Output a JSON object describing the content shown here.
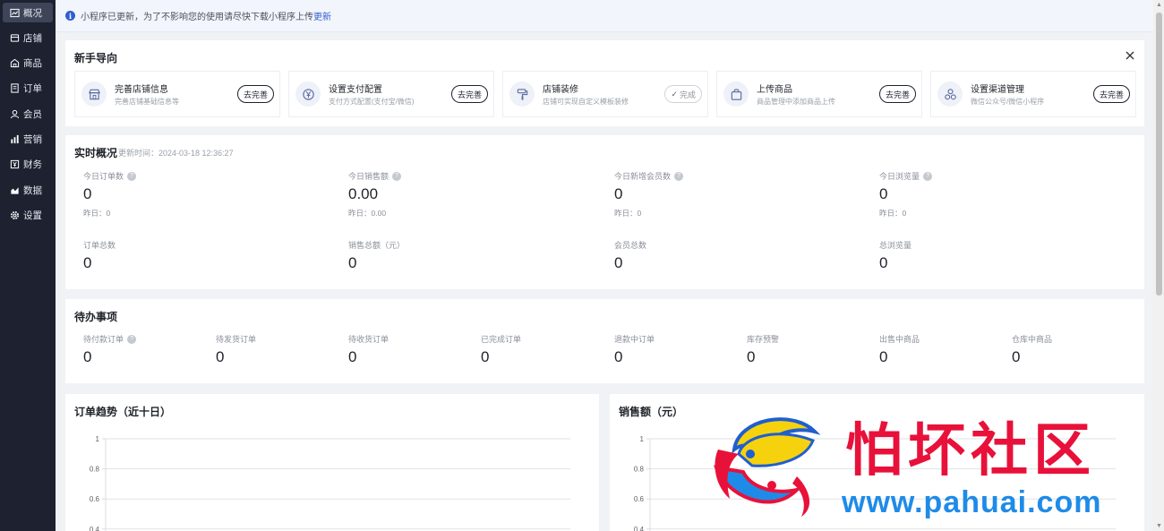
{
  "sidebar": {
    "items": [
      {
        "label": "概况",
        "icon": "chart-icon"
      },
      {
        "label": "店铺",
        "icon": "store-icon"
      },
      {
        "label": "商品",
        "icon": "goods-icon"
      },
      {
        "label": "订单",
        "icon": "order-icon"
      },
      {
        "label": "会员",
        "icon": "member-icon"
      },
      {
        "label": "营销",
        "icon": "marketing-icon"
      },
      {
        "label": "财务",
        "icon": "finance-icon"
      },
      {
        "label": "数据",
        "icon": "data-icon"
      },
      {
        "label": "设置",
        "icon": "settings-icon"
      }
    ]
  },
  "notice": {
    "text": "小程序已更新，为了不影响您的使用请尽快下载小程序上传",
    "link": "更新"
  },
  "guide": {
    "title": "新手导向",
    "items": [
      {
        "name": "完善店铺信息",
        "desc": "完善店铺基础信息等",
        "button": "去完善",
        "done": false
      },
      {
        "name": "设置支付配置",
        "desc": "支付方式配置(支付宝/微信)",
        "button": "去完善",
        "done": false
      },
      {
        "name": "店铺装修",
        "desc": "店铺可实现自定义模板装修",
        "button": "完成",
        "done": true
      },
      {
        "name": "上传商品",
        "desc": "商品管理中添加商品上传",
        "button": "去完善",
        "done": false
      },
      {
        "name": "设置渠道管理",
        "desc": "微信公众号/微信小程序",
        "button": "去完善",
        "done": false
      }
    ]
  },
  "realtime": {
    "title": "实时概况",
    "update_time": "更新时间：2024-03-18 12:36:27",
    "stats": [
      {
        "label": "今日订单数",
        "value": "0",
        "sub": "昨日：0",
        "help": true
      },
      {
        "label": "今日销售额",
        "value": "0.00",
        "sub": "昨日：0.00",
        "help": true
      },
      {
        "label": "今日新增会员数",
        "value": "0",
        "sub": "昨日：0",
        "help": true
      },
      {
        "label": "今日浏览量",
        "value": "0",
        "sub": "昨日：0",
        "help": true
      },
      {
        "label": "订单总数",
        "value": "0"
      },
      {
        "label": "销售总额（元）",
        "value": "0"
      },
      {
        "label": "会员总数",
        "value": "0"
      },
      {
        "label": "总浏览量",
        "value": "0"
      }
    ]
  },
  "todo": {
    "title": "待办事项",
    "items": [
      {
        "label": "待付款订单",
        "value": "0",
        "help": true
      },
      {
        "label": "待发货订单",
        "value": "0"
      },
      {
        "label": "待收货订单",
        "value": "0"
      },
      {
        "label": "已完成订单",
        "value": "0"
      },
      {
        "label": "退款中订单",
        "value": "0"
      },
      {
        "label": "库存预警",
        "value": "0"
      },
      {
        "label": "出售中商品",
        "value": "0"
      },
      {
        "label": "仓库中商品",
        "value": "0"
      }
    ]
  },
  "chart_data": [
    {
      "type": "line",
      "title": "订单趋势（近十日）",
      "ylim": [
        0,
        1
      ],
      "yticks": [
        "1",
        "0.8",
        "0.6",
        "0.4"
      ],
      "series": []
    },
    {
      "type": "line",
      "title": "销售额（元）",
      "ylim": [
        0,
        1
      ],
      "yticks": [
        "1",
        "0.8",
        "0.6",
        "0.4"
      ],
      "series": []
    }
  ],
  "watermark": {
    "brand": "怕坏社区",
    "url": "www.pahuai.com"
  },
  "colors": {
    "sidebar_bg": "#1d2130",
    "accent": "#2f5fd0",
    "watermark_red": "#e8113a",
    "watermark_blue": "#1f8be8"
  }
}
